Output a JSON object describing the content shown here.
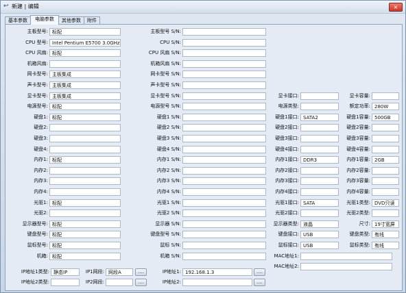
{
  "window": {
    "title": "新建 | 编辑",
    "close_glyph": "×",
    "app_icon": "back-arrow-icon"
  },
  "tabs": [
    "基本参数",
    "电脑参数",
    "其他参数",
    "附件"
  ],
  "col1": [
    {
      "label": "主板型号:",
      "value": "标配"
    },
    {
      "label": "CPU 型号:",
      "value": "Intel Pentium E5700 3.0GHz"
    },
    {
      "label": "CPU 风扇:",
      "value": "标配"
    },
    {
      "label": "机箱风扇:",
      "value": ""
    },
    {
      "label": "网卡型号:",
      "value": "主板集成"
    },
    {
      "label": "声卡型号:",
      "value": "主板集成"
    },
    {
      "label": "显卡型号:",
      "value": "主板集成"
    },
    {
      "label": "电源型号:",
      "value": "标配"
    },
    {
      "label": "硬盘1:",
      "value": "标配"
    },
    {
      "label": "硬盘2:",
      "value": ""
    },
    {
      "label": "硬盘3:",
      "value": ""
    },
    {
      "label": "硬盘4:",
      "value": ""
    },
    {
      "label": "内存1:",
      "value": "标配"
    },
    {
      "label": "内存2:",
      "value": ""
    },
    {
      "label": "内存3:",
      "value": ""
    },
    {
      "label": "内存4:",
      "value": ""
    },
    {
      "label": "光驱1:",
      "value": "标配"
    },
    {
      "label": "光驱2:",
      "value": ""
    },
    {
      "label": "显示器型号:",
      "value": "标配"
    },
    {
      "label": "键盘型号:",
      "value": "标配"
    },
    {
      "label": "鼠标型号:",
      "value": "标配"
    },
    {
      "label": "机箱:",
      "value": "标配"
    }
  ],
  "col2": [
    {
      "label": "主板型号 S/N:",
      "value": ""
    },
    {
      "label": "CPU S/N:",
      "value": ""
    },
    {
      "label": "CPU 风扇 S/N:",
      "value": ""
    },
    {
      "label": "机箱风扇 S/N:",
      "value": ""
    },
    {
      "label": "网卡型号 S/N:",
      "value": ""
    },
    {
      "label": "声卡型号 S/N:",
      "value": ""
    },
    {
      "label": "显卡型号 S/N:",
      "value": ""
    },
    {
      "label": "电源型号 S/N:",
      "value": ""
    },
    {
      "label": "硬盘1 S/N:",
      "value": ""
    },
    {
      "label": "硬盘2 S/N:",
      "value": ""
    },
    {
      "label": "硬盘3 S/N:",
      "value": ""
    },
    {
      "label": "硬盘4 S/N:",
      "value": ""
    },
    {
      "label": "内存1 S/N:",
      "value": ""
    },
    {
      "label": "内存2 S/N:",
      "value": ""
    },
    {
      "label": "内存3 S/N:",
      "value": ""
    },
    {
      "label": "内存4 S/N:",
      "value": ""
    },
    {
      "label": "光驱1 S/N:",
      "value": ""
    },
    {
      "label": "光驱2 S/N:",
      "value": ""
    },
    {
      "label": "显示器 S/N:",
      "value": ""
    },
    {
      "label": "键盘型号 S/N:",
      "value": ""
    },
    {
      "label": "鼠标 S/N:",
      "value": ""
    },
    {
      "label": "机箱 S/N:",
      "value": ""
    }
  ],
  "col3": [
    {
      "label": "显卡接口:",
      "value": "",
      "label2": "显卡容量:",
      "value2": ""
    },
    {
      "label": "电源类型:",
      "value": "",
      "label2": "额定功率:",
      "value2": "280W"
    },
    {
      "label": "硬盘1接口:",
      "value": "SATA2",
      "label2": "硬盘1容量:",
      "value2": "500GB"
    },
    {
      "label": "硬盘2接口:",
      "value": "",
      "label2": "硬盘2容量:",
      "value2": ""
    },
    {
      "label": "硬盘3接口:",
      "value": "",
      "label2": "硬盘3容量:",
      "value2": ""
    },
    {
      "label": "硬盘4接口:",
      "value": "",
      "label2": "硬盘4容量:",
      "value2": ""
    },
    {
      "label": "内存1接口:",
      "value": "DDR3",
      "label2": "内存1容量:",
      "value2": "2GB"
    },
    {
      "label": "内存2接口:",
      "value": "",
      "label2": "内存2容量:",
      "value2": ""
    },
    {
      "label": "内存3接口:",
      "value": "",
      "label2": "内存3容量:",
      "value2": ""
    },
    {
      "label": "内存4接口:",
      "value": "",
      "label2": "内存4容量:",
      "value2": ""
    },
    {
      "label": "光驱1接口:",
      "value": "SATA",
      "label2": "光驱1类型:",
      "value2": "DVD只读"
    },
    {
      "label": "光驱2接口:",
      "value": "",
      "label2": "光驱2类型:",
      "value2": ""
    },
    {
      "label": "显示器类型:",
      "value": "液晶",
      "label2": "尺寸:",
      "value2": "19寸宽屏"
    },
    {
      "label": "键盘接口:",
      "value": "USB",
      "label2": "键盘类型:",
      "value2": "有线"
    },
    {
      "label": "鼠标接口:",
      "value": "USB",
      "label2": "鼠标类型:",
      "value2": "有线"
    }
  ],
  "mac": [
    {
      "label": "MAC地址1:",
      "value": ""
    },
    {
      "label": "MAC地址2:",
      "value": ""
    }
  ],
  "ip_row1": {
    "type_label": "IP地址1类型:",
    "type_value": "静态IP",
    "gw_label": "IP1网段:",
    "gw_value": "网段A",
    "ip_label": "IP地址1:",
    "ip_value": "192.168.1.3",
    "button": "...."
  },
  "ip_row2": {
    "type_label": "IP地址2类型:",
    "type_value": "",
    "gw_label": "IP2网段:",
    "gw_value": "",
    "ip_label": "IP地址2:",
    "ip_value": "",
    "button": "...."
  }
}
